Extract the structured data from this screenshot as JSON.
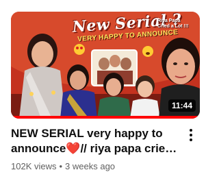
{
  "thumbnail": {
    "banner_title": "New Serial ?",
    "banner_subtitle": "VERY HAPPY TO ANNOUNCE",
    "corner_caption": "Riya Papa Cried a Lot !!!",
    "duration": "11:44",
    "watched_fraction": 1.0
  },
  "video": {
    "title": "NEW SERIAL very happy to announce❤️// riya papa cried a lot...",
    "views": "102K views",
    "separator": "•",
    "age": "3 weeks ago"
  },
  "colors": {
    "progress": "#ff0000",
    "title_text": "#0f0f0f",
    "meta_text": "#606060"
  },
  "icons": {
    "menu": "more-vert-icon"
  }
}
